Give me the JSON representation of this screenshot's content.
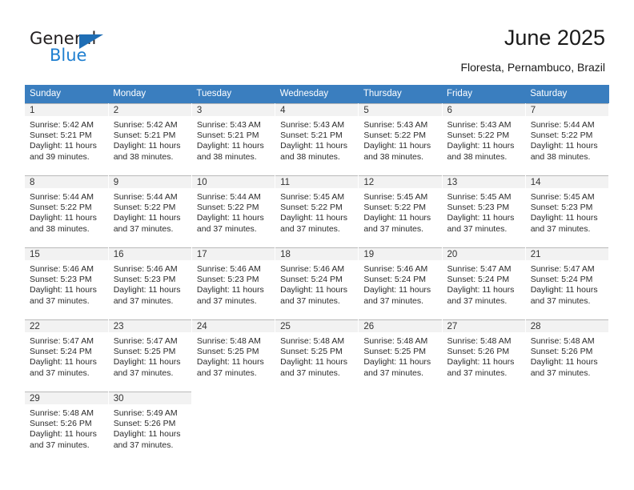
{
  "brand": {
    "name_top": "General",
    "name_bottom": "Blue",
    "triangle_color": "#1f6eb5",
    "blue_color": "#1f7fd0"
  },
  "header": {
    "title": "June 2025",
    "subtitle": "Floresta, Pernambuco, Brazil"
  },
  "theme": {
    "header_row_bg": "#3a7ebf",
    "header_row_text": "#ffffff",
    "daynum_bg": "#f2f2f2",
    "cell_border": "#b9b9b9"
  },
  "weekdays": [
    "Sunday",
    "Monday",
    "Tuesday",
    "Wednesday",
    "Thursday",
    "Friday",
    "Saturday"
  ],
  "labels": {
    "sunrise_prefix": "Sunrise:",
    "sunset_prefix": "Sunset:",
    "daylight_prefix": "Daylight:"
  },
  "weeks": [
    [
      {
        "day": "1",
        "sunrise": "Sunrise: 5:42 AM",
        "sunset": "Sunset: 5:21 PM",
        "daylight1": "Daylight: 11 hours",
        "daylight2": "and 39 minutes."
      },
      {
        "day": "2",
        "sunrise": "Sunrise: 5:42 AM",
        "sunset": "Sunset: 5:21 PM",
        "daylight1": "Daylight: 11 hours",
        "daylight2": "and 38 minutes."
      },
      {
        "day": "3",
        "sunrise": "Sunrise: 5:43 AM",
        "sunset": "Sunset: 5:21 PM",
        "daylight1": "Daylight: 11 hours",
        "daylight2": "and 38 minutes."
      },
      {
        "day": "4",
        "sunrise": "Sunrise: 5:43 AM",
        "sunset": "Sunset: 5:21 PM",
        "daylight1": "Daylight: 11 hours",
        "daylight2": "and 38 minutes."
      },
      {
        "day": "5",
        "sunrise": "Sunrise: 5:43 AM",
        "sunset": "Sunset: 5:22 PM",
        "daylight1": "Daylight: 11 hours",
        "daylight2": "and 38 minutes."
      },
      {
        "day": "6",
        "sunrise": "Sunrise: 5:43 AM",
        "sunset": "Sunset: 5:22 PM",
        "daylight1": "Daylight: 11 hours",
        "daylight2": "and 38 minutes."
      },
      {
        "day": "7",
        "sunrise": "Sunrise: 5:44 AM",
        "sunset": "Sunset: 5:22 PM",
        "daylight1": "Daylight: 11 hours",
        "daylight2": "and 38 minutes."
      }
    ],
    [
      {
        "day": "8",
        "sunrise": "Sunrise: 5:44 AM",
        "sunset": "Sunset: 5:22 PM",
        "daylight1": "Daylight: 11 hours",
        "daylight2": "and 38 minutes."
      },
      {
        "day": "9",
        "sunrise": "Sunrise: 5:44 AM",
        "sunset": "Sunset: 5:22 PM",
        "daylight1": "Daylight: 11 hours",
        "daylight2": "and 37 minutes."
      },
      {
        "day": "10",
        "sunrise": "Sunrise: 5:44 AM",
        "sunset": "Sunset: 5:22 PM",
        "daylight1": "Daylight: 11 hours",
        "daylight2": "and 37 minutes."
      },
      {
        "day": "11",
        "sunrise": "Sunrise: 5:45 AM",
        "sunset": "Sunset: 5:22 PM",
        "daylight1": "Daylight: 11 hours",
        "daylight2": "and 37 minutes."
      },
      {
        "day": "12",
        "sunrise": "Sunrise: 5:45 AM",
        "sunset": "Sunset: 5:22 PM",
        "daylight1": "Daylight: 11 hours",
        "daylight2": "and 37 minutes."
      },
      {
        "day": "13",
        "sunrise": "Sunrise: 5:45 AM",
        "sunset": "Sunset: 5:23 PM",
        "daylight1": "Daylight: 11 hours",
        "daylight2": "and 37 minutes."
      },
      {
        "day": "14",
        "sunrise": "Sunrise: 5:45 AM",
        "sunset": "Sunset: 5:23 PM",
        "daylight1": "Daylight: 11 hours",
        "daylight2": "and 37 minutes."
      }
    ],
    [
      {
        "day": "15",
        "sunrise": "Sunrise: 5:46 AM",
        "sunset": "Sunset: 5:23 PM",
        "daylight1": "Daylight: 11 hours",
        "daylight2": "and 37 minutes."
      },
      {
        "day": "16",
        "sunrise": "Sunrise: 5:46 AM",
        "sunset": "Sunset: 5:23 PM",
        "daylight1": "Daylight: 11 hours",
        "daylight2": "and 37 minutes."
      },
      {
        "day": "17",
        "sunrise": "Sunrise: 5:46 AM",
        "sunset": "Sunset: 5:23 PM",
        "daylight1": "Daylight: 11 hours",
        "daylight2": "and 37 minutes."
      },
      {
        "day": "18",
        "sunrise": "Sunrise: 5:46 AM",
        "sunset": "Sunset: 5:24 PM",
        "daylight1": "Daylight: 11 hours",
        "daylight2": "and 37 minutes."
      },
      {
        "day": "19",
        "sunrise": "Sunrise: 5:46 AM",
        "sunset": "Sunset: 5:24 PM",
        "daylight1": "Daylight: 11 hours",
        "daylight2": "and 37 minutes."
      },
      {
        "day": "20",
        "sunrise": "Sunrise: 5:47 AM",
        "sunset": "Sunset: 5:24 PM",
        "daylight1": "Daylight: 11 hours",
        "daylight2": "and 37 minutes."
      },
      {
        "day": "21",
        "sunrise": "Sunrise: 5:47 AM",
        "sunset": "Sunset: 5:24 PM",
        "daylight1": "Daylight: 11 hours",
        "daylight2": "and 37 minutes."
      }
    ],
    [
      {
        "day": "22",
        "sunrise": "Sunrise: 5:47 AM",
        "sunset": "Sunset: 5:24 PM",
        "daylight1": "Daylight: 11 hours",
        "daylight2": "and 37 minutes."
      },
      {
        "day": "23",
        "sunrise": "Sunrise: 5:47 AM",
        "sunset": "Sunset: 5:25 PM",
        "daylight1": "Daylight: 11 hours",
        "daylight2": "and 37 minutes."
      },
      {
        "day": "24",
        "sunrise": "Sunrise: 5:48 AM",
        "sunset": "Sunset: 5:25 PM",
        "daylight1": "Daylight: 11 hours",
        "daylight2": "and 37 minutes."
      },
      {
        "day": "25",
        "sunrise": "Sunrise: 5:48 AM",
        "sunset": "Sunset: 5:25 PM",
        "daylight1": "Daylight: 11 hours",
        "daylight2": "and 37 minutes."
      },
      {
        "day": "26",
        "sunrise": "Sunrise: 5:48 AM",
        "sunset": "Sunset: 5:25 PM",
        "daylight1": "Daylight: 11 hours",
        "daylight2": "and 37 minutes."
      },
      {
        "day": "27",
        "sunrise": "Sunrise: 5:48 AM",
        "sunset": "Sunset: 5:26 PM",
        "daylight1": "Daylight: 11 hours",
        "daylight2": "and 37 minutes."
      },
      {
        "day": "28",
        "sunrise": "Sunrise: 5:48 AM",
        "sunset": "Sunset: 5:26 PM",
        "daylight1": "Daylight: 11 hours",
        "daylight2": "and 37 minutes."
      }
    ],
    [
      {
        "day": "29",
        "sunrise": "Sunrise: 5:48 AM",
        "sunset": "Sunset: 5:26 PM",
        "daylight1": "Daylight: 11 hours",
        "daylight2": "and 37 minutes."
      },
      {
        "day": "30",
        "sunrise": "Sunrise: 5:49 AM",
        "sunset": "Sunset: 5:26 PM",
        "daylight1": "Daylight: 11 hours",
        "daylight2": "and 37 minutes."
      },
      {
        "day": "",
        "sunrise": "",
        "sunset": "",
        "daylight1": "",
        "daylight2": "",
        "blank": true
      },
      {
        "day": "",
        "sunrise": "",
        "sunset": "",
        "daylight1": "",
        "daylight2": "",
        "blank": true
      },
      {
        "day": "",
        "sunrise": "",
        "sunset": "",
        "daylight1": "",
        "daylight2": "",
        "blank": true
      },
      {
        "day": "",
        "sunrise": "",
        "sunset": "",
        "daylight1": "",
        "daylight2": "",
        "blank": true
      },
      {
        "day": "",
        "sunrise": "",
        "sunset": "",
        "daylight1": "",
        "daylight2": "",
        "blank": true
      }
    ]
  ]
}
